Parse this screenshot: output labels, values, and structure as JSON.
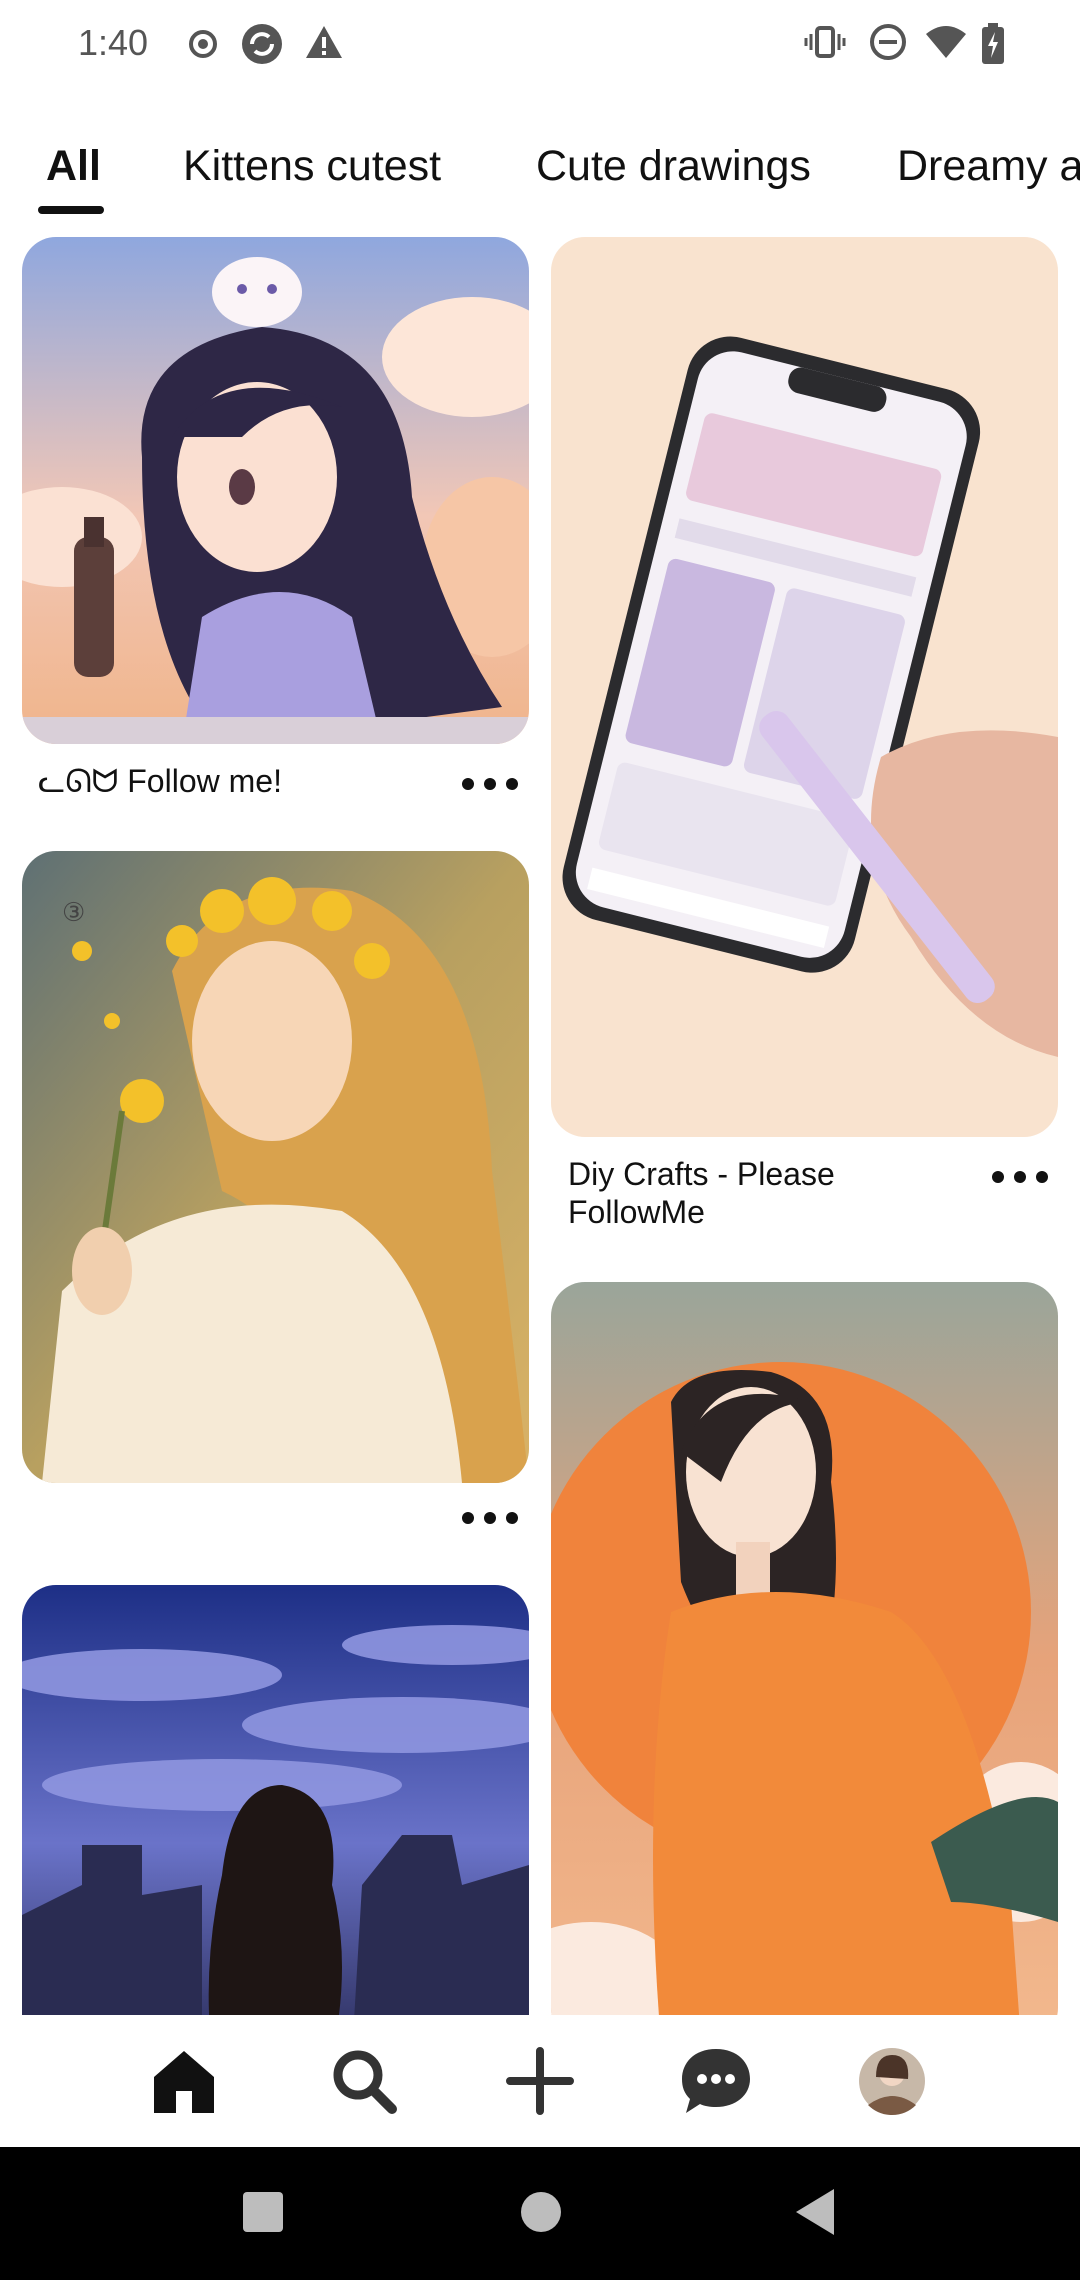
{
  "status_bar": {
    "time": "1:40",
    "left_icons": [
      "record-icon",
      "sync-icon",
      "warning-icon"
    ],
    "right_icons": [
      "vibrate-icon",
      "do-not-disturb-icon",
      "wifi-icon",
      "battery-charging-icon"
    ]
  },
  "tabs": [
    {
      "label": "All",
      "active": true
    },
    {
      "label": "Kittens cutest",
      "active": false
    },
    {
      "label": "Cute drawings",
      "active": false
    },
    {
      "label": "Dreamy a",
      "active": false
    }
  ],
  "pins": [
    {
      "title": "ᓚᘏᗢ Follow me!",
      "image": "anime girl with cat on head holding bottle",
      "more_icon": "more-icon"
    },
    {
      "title": "Diy Crafts - Please FollowMe",
      "image": "hand holding stylus on phone",
      "more_icon": "more-icon"
    },
    {
      "title": "",
      "image": "anime girl with yellow flowers",
      "more_icon": "more-icon"
    },
    {
      "title": "",
      "image": "girl in orange sweater",
      "more_icon": "more-icon"
    },
    {
      "title": "",
      "image": "girl under night sky",
      "more_icon": "more-icon"
    }
  ],
  "bottom_nav": [
    {
      "name": "home-icon",
      "active": true
    },
    {
      "name": "search-icon",
      "active": false
    },
    {
      "name": "create-icon",
      "active": false
    },
    {
      "name": "messages-icon",
      "active": false
    },
    {
      "name": "profile-avatar",
      "active": false
    }
  ],
  "system_nav": [
    "recents-button",
    "home-button",
    "back-button"
  ],
  "colors": {
    "accent": "#111111",
    "icon": "#333333",
    "background": "#ffffff"
  }
}
